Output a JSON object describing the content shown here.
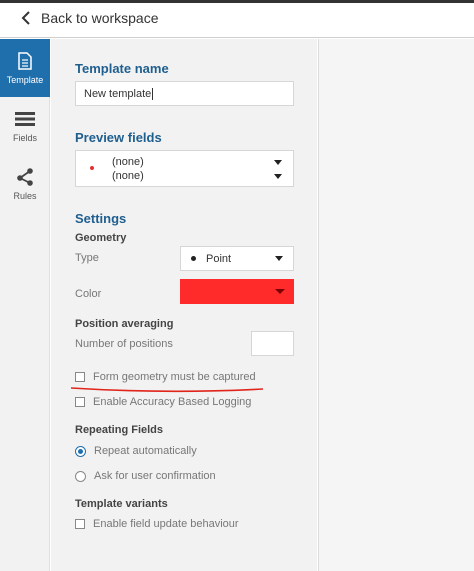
{
  "header": {
    "back_label": "Back to workspace"
  },
  "sidebar": {
    "items": [
      {
        "label": "Template",
        "icon": "document-icon",
        "active": true
      },
      {
        "label": "Fields",
        "icon": "list-icon",
        "active": false
      },
      {
        "label": "Rules",
        "icon": "share-nodes-icon",
        "active": false
      }
    ]
  },
  "template_name": {
    "title": "Template name",
    "value": "New template"
  },
  "preview_fields": {
    "title": "Preview fields",
    "field1": "(none)",
    "field2": "(none)"
  },
  "settings": {
    "title": "Settings",
    "geometry": {
      "title": "Geometry",
      "type_label": "Type",
      "type_value": "Point",
      "color_label": "Color",
      "color_value": "#ff2a2a"
    },
    "position_averaging": {
      "title": "Position averaging",
      "num_positions_label": "Number of positions",
      "num_positions_value": ""
    },
    "form_geometry_label": "Form geometry must be captured",
    "accuracy_label": "Enable Accuracy Based Logging",
    "repeating": {
      "title": "Repeating Fields",
      "repeat_auto": "Repeat automatically",
      "ask_confirm": "Ask for user confirmation"
    },
    "variants": {
      "title": "Template variants",
      "field_update": "Enable field update behaviour"
    }
  },
  "annotation_color": "#e0251b"
}
